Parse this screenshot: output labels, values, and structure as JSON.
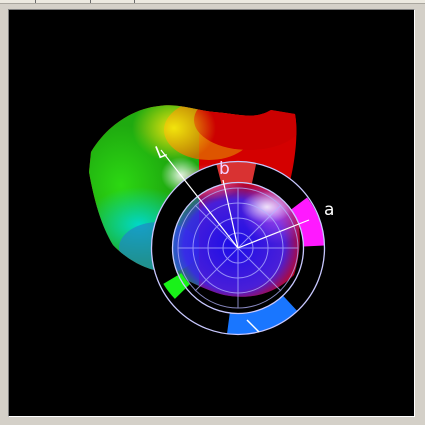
{
  "viewport": {
    "background": "#000000",
    "axes": {
      "l_label": "L",
      "a_label": "a",
      "b_label": "b"
    },
    "polar_grid": {
      "color": "#b4b4ff",
      "rings": 4,
      "spokes": 4
    },
    "hue_ring": {
      "segments": [
        {
          "name": "green",
          "color": "#19f219"
        },
        {
          "name": "blue",
          "color": "#1976ff"
        },
        {
          "name": "magenta",
          "color": "#ff19ff"
        },
        {
          "name": "red",
          "color": "#ff3b3b"
        }
      ]
    },
    "surface_colors": {
      "green": "#22c90f",
      "yellow": "#e8d90c",
      "red": "#e10000",
      "cyan": "#00c8c0",
      "blue": "#2a14e6",
      "magenta": "#ff19ff"
    }
  }
}
